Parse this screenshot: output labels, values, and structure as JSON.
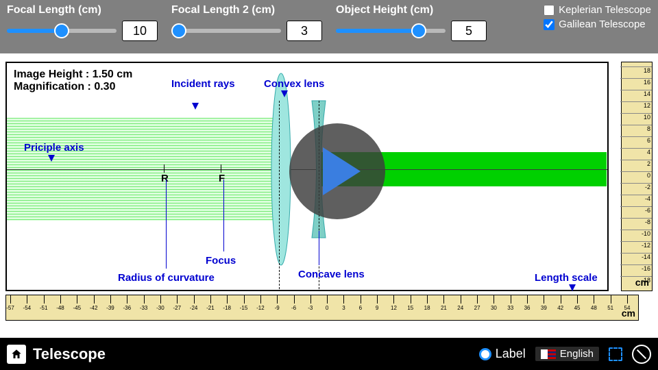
{
  "top": {
    "focal1": {
      "label": "Focal Length (cm)",
      "value": "10"
    },
    "focal2": {
      "label": "Focal Length 2 (cm)",
      "value": "3"
    },
    "objh": {
      "label": "Object Height (cm)",
      "value": "5"
    },
    "opt_kepler": "Keplerian Telescope",
    "opt_galileo": "Galilean Telescope"
  },
  "readout": {
    "imgh": "Image Height : 1.50 cm",
    "mag": "Magnification : 0.30"
  },
  "labels": {
    "incident": "Incident rays",
    "convex": "Convex lens",
    "principal": "Priciple axis",
    "focus": "Focus",
    "radius": "Radius of curvature",
    "concave": "Concave lens",
    "lenscale": "Length scale",
    "R": "R",
    "F": "F"
  },
  "ruler_v": {
    "unit": "cm",
    "ticks": [
      18,
      16,
      14,
      12,
      10,
      8,
      6,
      4,
      2,
      0,
      -2,
      -4,
      -6,
      -8,
      -10,
      -12,
      -14,
      -16,
      -18
    ]
  },
  "ruler_h": {
    "unit": "cm",
    "ticks": [
      -57,
      -54,
      -51,
      -48,
      -45,
      -42,
      -39,
      -36,
      -33,
      -30,
      -27,
      -24,
      -21,
      -18,
      -15,
      -12,
      -9,
      -6,
      -3,
      0,
      3,
      6,
      9,
      12,
      15,
      18,
      21,
      24,
      27,
      30,
      33,
      36,
      39,
      42,
      45,
      48,
      51,
      54
    ]
  },
  "bottom": {
    "title": "Telescope",
    "label_btn": "Label",
    "lang": "English"
  }
}
